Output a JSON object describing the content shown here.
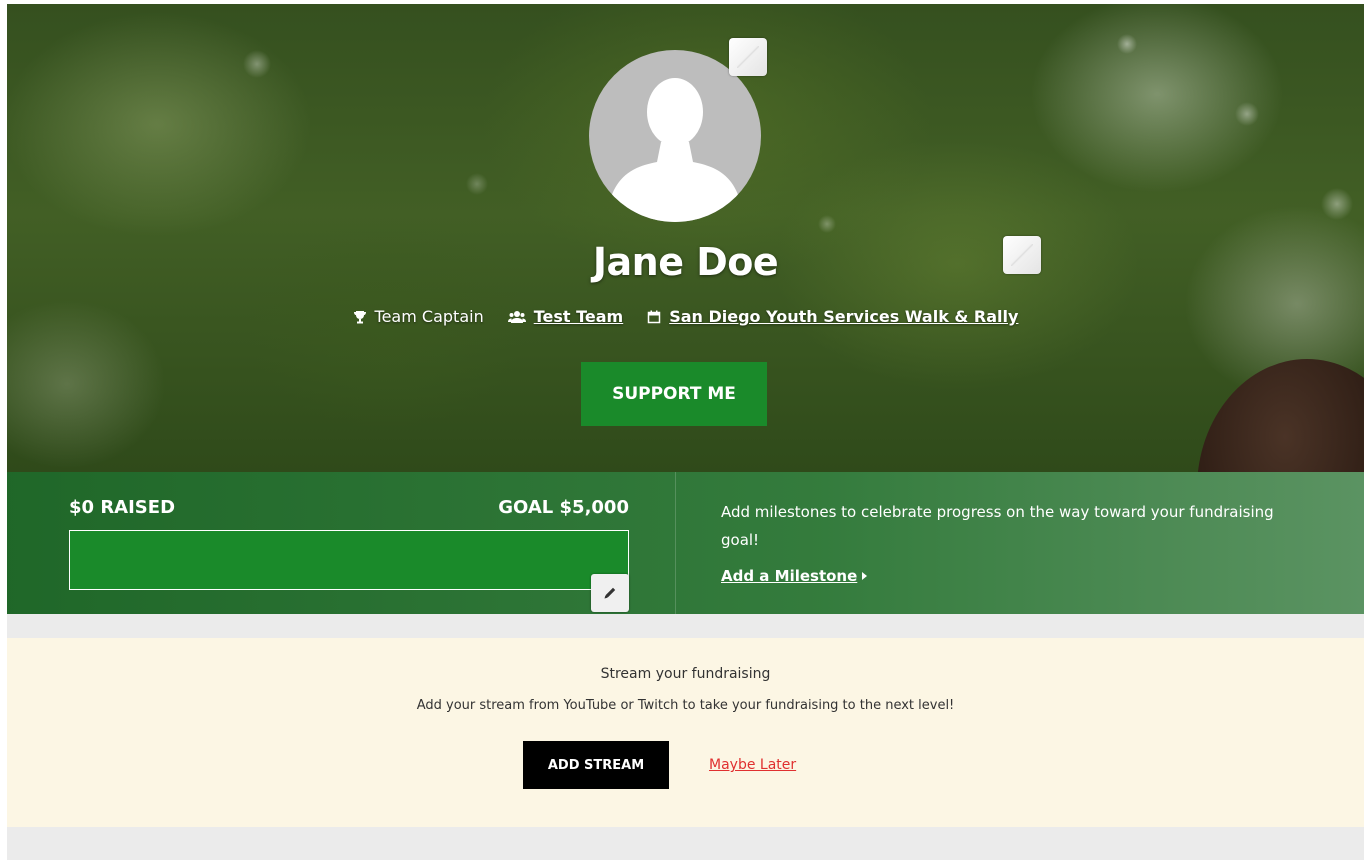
{
  "profile": {
    "name": "Jane Doe",
    "role": "Team Captain",
    "team_link": "Test Team",
    "event_link": "San Diego Youth Services Walk & Rally",
    "support_button": "SUPPORT ME"
  },
  "stats": {
    "raised": "$0 RAISED",
    "goal": "GOAL $5,000",
    "progress_fraction": 0,
    "milestone_text": "Add milestones to celebrate progress on the way toward your fundraising goal!",
    "milestone_link": "Add a Milestone"
  },
  "stream": {
    "title": "Stream your fundraising",
    "description": "Add your stream from YouTube or Twitch to take your fundraising to the next level!",
    "add_button": "ADD STREAM",
    "later_link": "Maybe Later"
  },
  "colors": {
    "brand_green": "#1a8a2a",
    "stream_bg": "#fcf6e4",
    "later_link": "#e03030"
  },
  "icons": {
    "role": "trophy-icon",
    "team": "users-icon",
    "event": "calendar-icon",
    "edit": "pencil-icon",
    "milestone": "caret-right-icon"
  }
}
